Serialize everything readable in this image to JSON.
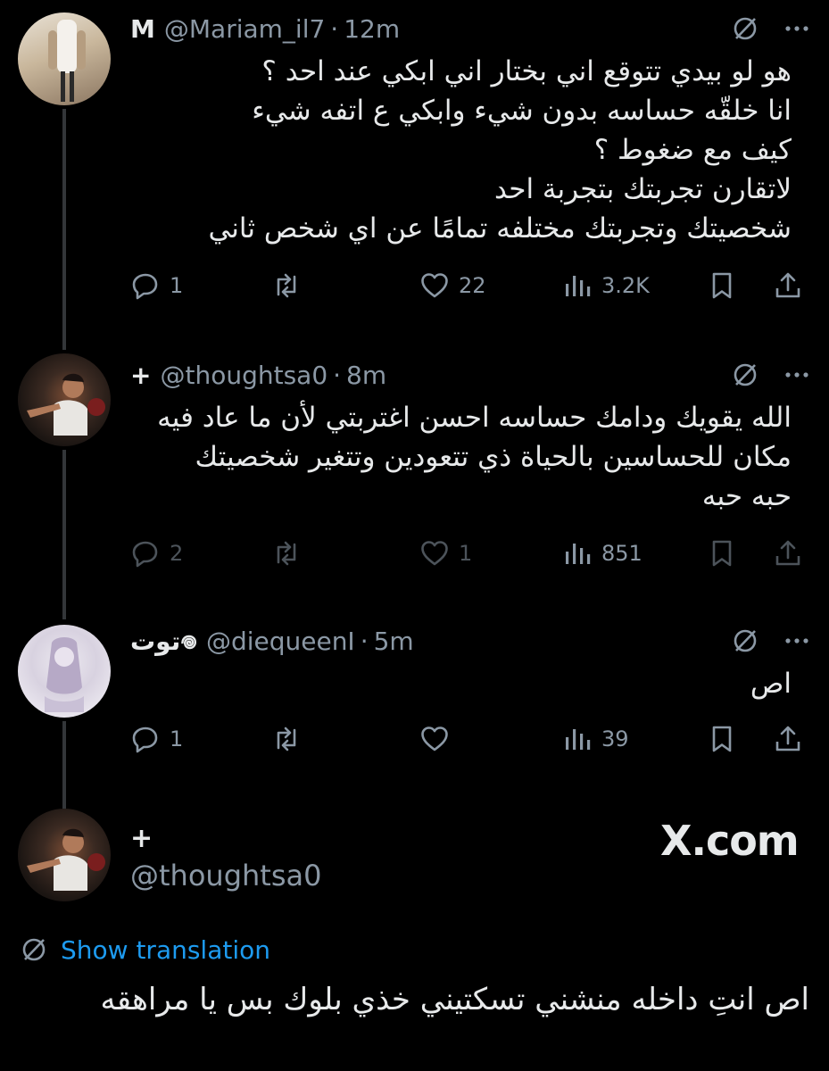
{
  "tweets": [
    {
      "name": "M",
      "handle": "@Mariam_il7",
      "separator": "·",
      "time": "12m",
      "body": "هو لو بيدي تتوقع اني بختار اني ابكي عند احد ؟\nانا خلقّه حساسه بدون شيء وابكي ع اتفه شيء\nكيف مع ضغوط ؟\nلاتقارن تجربتك بتجربة احد\nشخصيتك وتجربتك مختلفه تمامًا عن اي شخص ثاني",
      "replies": "1",
      "reposts": "",
      "likes": "22",
      "views": "3.2K"
    },
    {
      "name": "+",
      "handle": "@thoughtsa0",
      "separator": "·",
      "time": "8m",
      "body": "الله يقويك ودامك حساسه احسن اغتربتي لأن ما عاد فيه\nمكان للحساسين بالحياة ذي تتعودين وتتغير شخصيتك\nحبه حبه",
      "replies": "2",
      "reposts": "",
      "likes": "1",
      "views": "851"
    },
    {
      "name": "توت𖦹",
      "handle": "@diequeenI",
      "separator": "·",
      "time": "5m",
      "body": "اص",
      "replies": "1",
      "reposts": "",
      "likes": "",
      "views": "39"
    }
  ],
  "quote": {
    "name": "+",
    "handle": "@thoughtsa0",
    "watermark": "X.com",
    "show_translation": "Show translation",
    "body": "اص انتِ داخله منشني تسكتيني خذي بلوك بس يا مراهقه"
  },
  "icons": [
    "grok-icon",
    "more-icon",
    "reply-icon",
    "repost-icon",
    "like-icon",
    "views-icon",
    "bookmark-icon",
    "share-icon",
    "translate-icon"
  ],
  "colors": {
    "background": "#000000",
    "text": "#e7e9ea",
    "muted": "#8b98a5",
    "link": "#1d9bf0"
  }
}
